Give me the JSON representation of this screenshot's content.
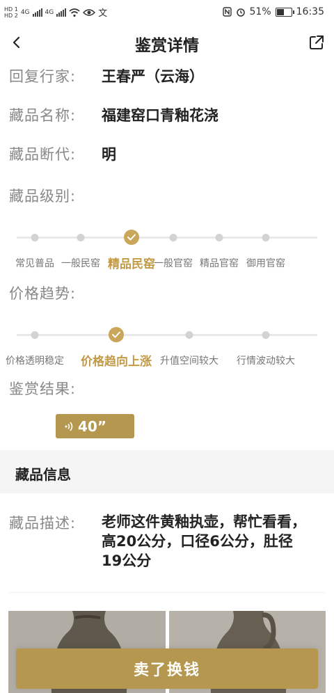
{
  "status_bar": {
    "time": "16:35",
    "battery": "51%",
    "hd1": "HD 1",
    "hd2": "HD 2",
    "net1": "4G",
    "net2": "4G",
    "icons": [
      "hd-icon",
      "signal-icon",
      "wifi-icon",
      "eye-icon",
      "translate-icon",
      "nfc-icon",
      "alarm-icon",
      "battery-icon"
    ]
  },
  "nav": {
    "title": "鉴赏详情",
    "back_icon": "chevron-left-icon",
    "share_icon": "share-icon"
  },
  "details": [
    {
      "label": "回复行家:",
      "value": "王春严（云海）"
    },
    {
      "label": "藏品名称:",
      "value": "福建窑口青釉花浇"
    },
    {
      "label": "藏品断代:",
      "value": "明"
    }
  ],
  "grade": {
    "label": "藏品级别:",
    "options": [
      "常见普品",
      "一般民窑",
      "精品民窑",
      "一般官窑",
      "精品官窑",
      "御用官窑"
    ],
    "selected_index": 2
  },
  "trend": {
    "label": "价格趋势:",
    "options": [
      "价格透明稳定",
      "价格趋向上涨",
      "升值空间较大",
      "行情波动较大"
    ],
    "selected_index": 1
  },
  "result": {
    "label": "鉴赏结果:",
    "audio_duration": "40”",
    "audio_icon": "voice-wave-icon"
  },
  "info_section": {
    "title": "藏品信息",
    "desc_label": "藏品描述:",
    "desc_value": "老师这件黄釉执壶，帮忙看看，高20公分，口径6公分，肚径19公分"
  },
  "action": {
    "sell_label": "卖了换钱"
  },
  "colors": {
    "accent": "#b6974f",
    "accent_text": "#c29a46",
    "track": "#e9e9e9"
  }
}
